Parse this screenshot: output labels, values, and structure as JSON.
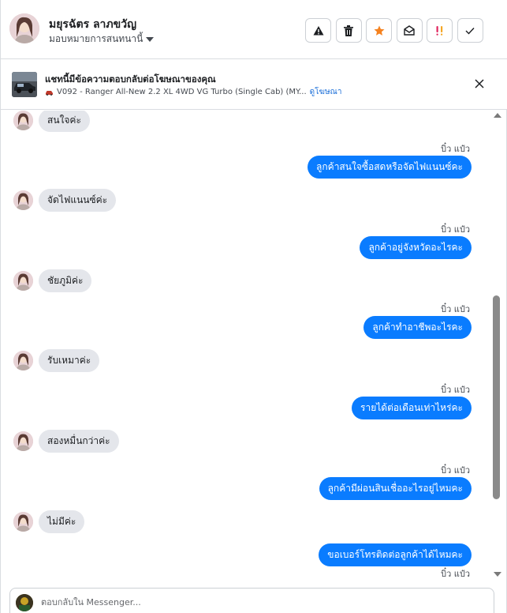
{
  "header": {
    "contact_name": "มยุรฉัตร ลาภขวัญ",
    "assign_label": "มอบหมายการสนทนานี้",
    "tools": [
      {
        "icon": "warning-icon",
        "label": "spam"
      },
      {
        "icon": "trash-icon",
        "label": "delete"
      },
      {
        "icon": "star-icon",
        "label": "follow up",
        "color": "#f5821f"
      },
      {
        "icon": "envelope-open-icon",
        "label": "mark unread"
      },
      {
        "icon": "priority-icon",
        "label": "priority",
        "color": "#e0245e"
      },
      {
        "icon": "check-icon",
        "label": "done"
      }
    ]
  },
  "ad": {
    "title": "แชทนี้มีข้อความตอบกลับต่อโฆษณาของคุณ",
    "subtitle": "V092 - Ranger All-New 2.2 XL 4WD VG Turbo (Single Cab) (MY...",
    "link": "ดูโฆษณา"
  },
  "messages": [
    {
      "direction": "in",
      "text": "สนใจค่ะ"
    },
    {
      "direction": "out",
      "sender": "บิ๋ว แป๋ว",
      "text": "ลูกค้าสนใจซื้อสดหรือจัดไฟแนนซ์คะ"
    },
    {
      "direction": "in",
      "text": "จัดไฟแนนซ์ค่ะ"
    },
    {
      "direction": "out",
      "sender": "บิ๋ว แป๋ว",
      "text": "ลูกค้าอยู่จังหวัดอะไรคะ"
    },
    {
      "direction": "in",
      "text": "ชัยภูมิค่ะ"
    },
    {
      "direction": "out",
      "sender": "บิ๋ว แป๋ว",
      "text": "ลูกค้าทำอาชีพอะไรคะ"
    },
    {
      "direction": "in",
      "text": "รับเหมาค่ะ"
    },
    {
      "direction": "out",
      "sender": "บิ๋ว แป๋ว",
      "text": "รายได้ต่อเดือนเท่าไหร่คะ"
    },
    {
      "direction": "in",
      "text": "สองหมื่นกว่าค่ะ"
    },
    {
      "direction": "out",
      "sender": "บิ๋ว แป๋ว",
      "text": "ลูกค้ามีผ่อนสินเชื่ออะไรอยู่ไหมคะ"
    },
    {
      "direction": "in",
      "text": "ไม่มีค่ะ"
    },
    {
      "direction": "out",
      "text": "ขอเบอร์โทรติดต่อลูกค้าได้ไหมคะ"
    },
    {
      "direction": "sender_only",
      "sender": "บิ๋ว แป๋ว"
    }
  ],
  "composer": {
    "placeholder": "ตอบกลับใน Messenger..."
  },
  "colors": {
    "outgoing_bubble": "#0a7cff",
    "incoming_bubble": "#e4e6eb",
    "link": "#1a6ed8"
  }
}
